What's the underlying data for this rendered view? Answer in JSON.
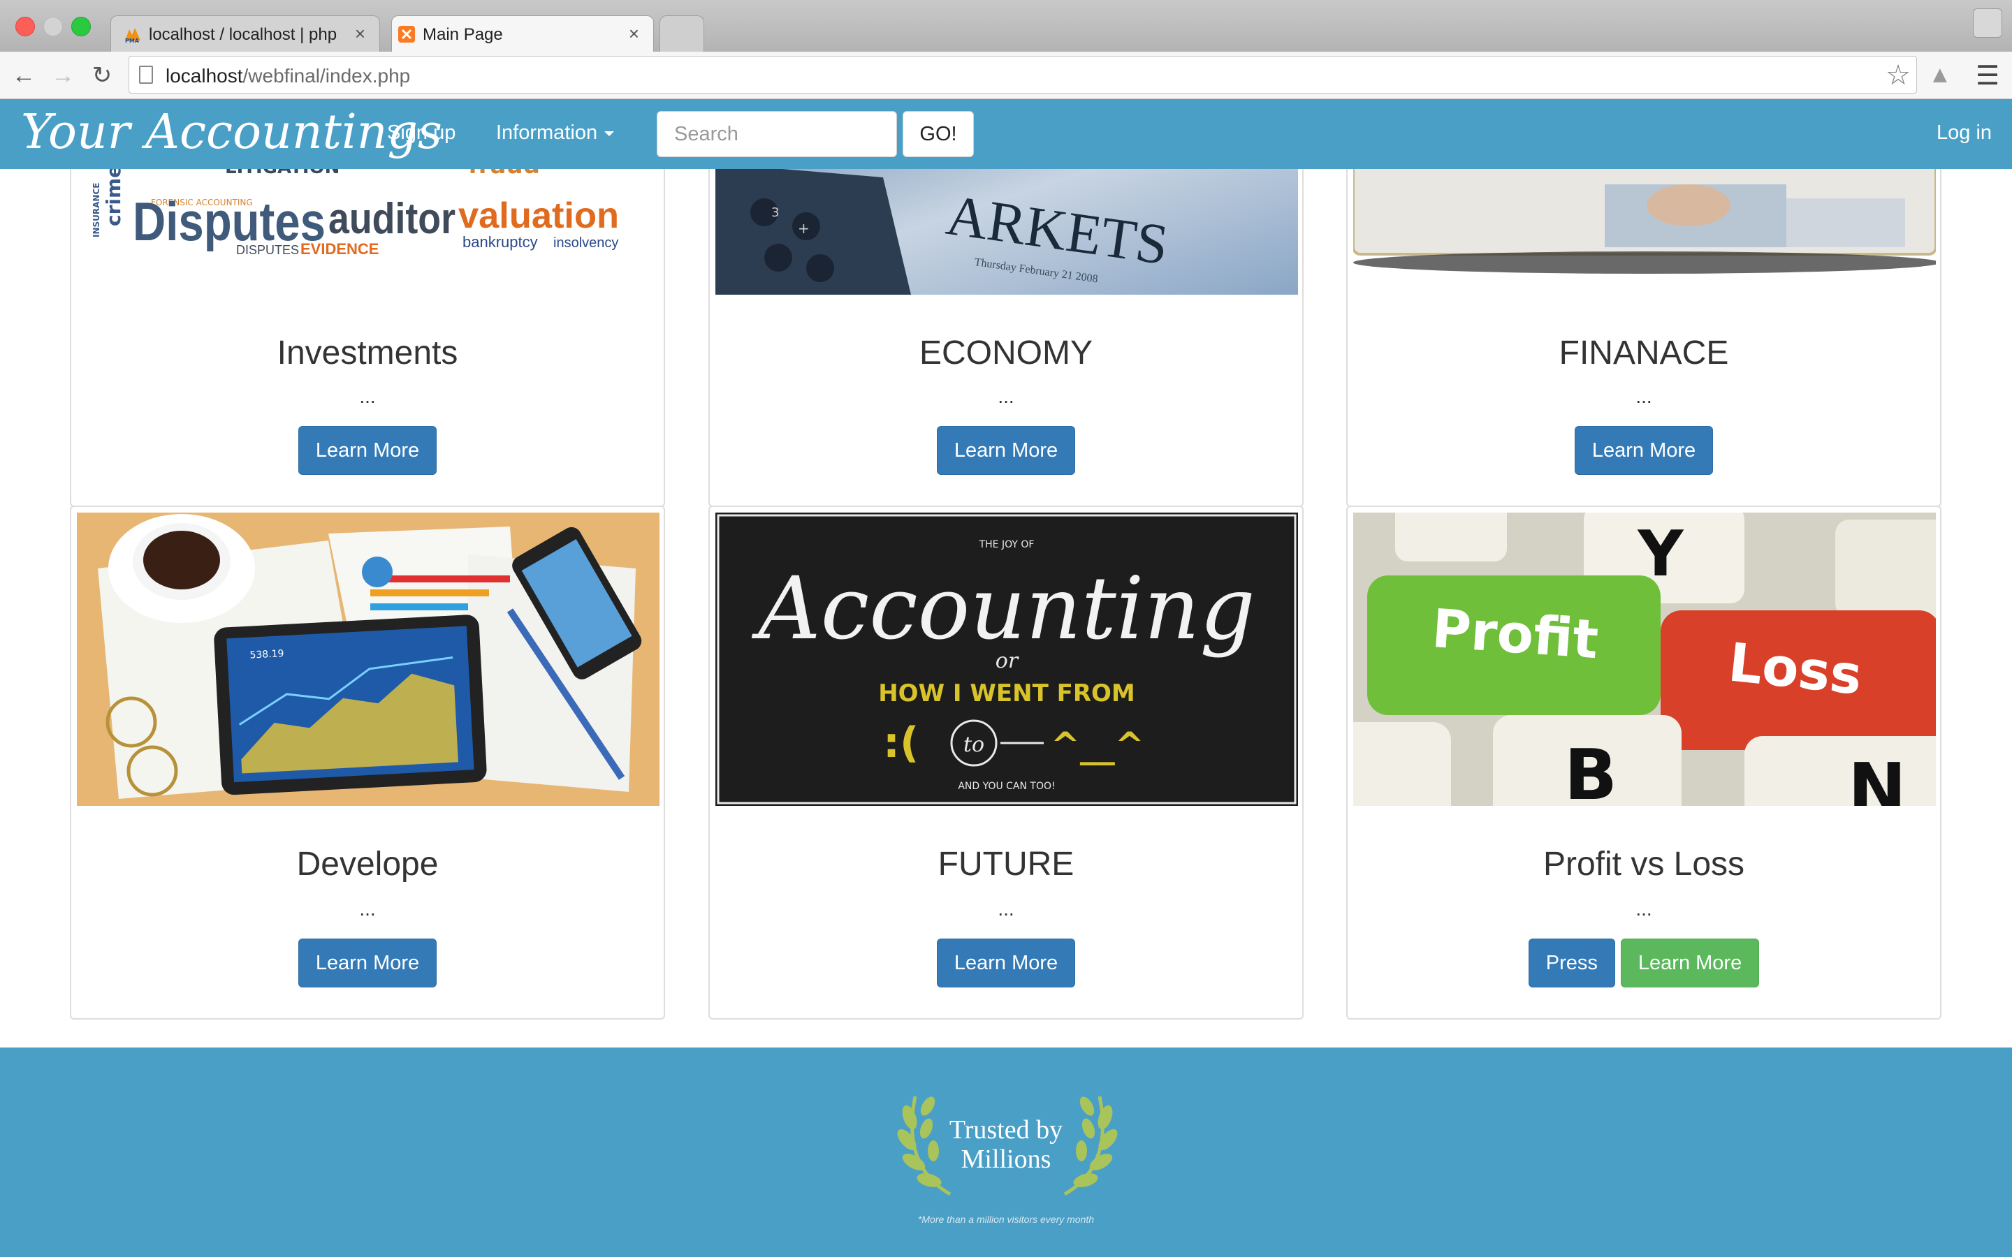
{
  "browser": {
    "tabs": [
      {
        "label": "localhost / localhost | phpMyAdmin",
        "favicon": "pma-icon"
      },
      {
        "label": "Main Page",
        "favicon": "xampp-icon"
      }
    ],
    "close_glyph": "×",
    "url_host": "localhost",
    "url_path": "/webfinal/index.php"
  },
  "nav": {
    "brand": "Your Accountings",
    "signup": "Sign up",
    "information": "Information",
    "search_placeholder": "Search",
    "go": "GO!",
    "login": "Log in"
  },
  "cards": [
    {
      "title": "Investments",
      "text": "...",
      "buttons": [
        "Learn More"
      ],
      "image": "word-cloud: Disputes, auditor, valuation, crime, insurance, bankruptcy, insolvency, evidence"
    },
    {
      "title": "ECONOMY",
      "text": "...",
      "buttons": [
        "Learn More"
      ],
      "image": "calculator-markets-newspaper"
    },
    {
      "title": "FINANACE",
      "text": "...",
      "buttons": [
        "Learn More"
      ],
      "image": "handshake-photo"
    },
    {
      "title": "Develope",
      "text": "...",
      "buttons": [
        "Learn More"
      ],
      "image": "tablet-charts-coffee"
    },
    {
      "title": "FUTURE",
      "text": "...",
      "buttons": [
        "Learn More"
      ],
      "image": "chalkboard-accounting"
    },
    {
      "title": "Profit vs Loss",
      "text": "...",
      "buttons": [
        "Press",
        "Learn More"
      ],
      "image": "profit-loss-keyboard"
    }
  ],
  "image_text": {
    "markets": "ARKETS",
    "markets_date": "Thursday February 21 2008",
    "tablet_value": "538.19",
    "joy": "THE JOY OF",
    "accounting": "Accounting",
    "or": "or",
    "how": "HOW I WENT FROM",
    "to": "to",
    "and_you": "AND YOU CAN TOO!",
    "key_profit": "Profit",
    "key_loss": "Loss",
    "key_y": "Y",
    "key_b": "B",
    "key_n": "N"
  },
  "word_cloud": {
    "disputes": "Disputes",
    "auditor": "auditor",
    "valuation": "valuation",
    "crime": "crime",
    "insurance": "INSURANCE",
    "bankruptcy": "bankruptcy",
    "insolvency": "insolvency",
    "evidence": "EVIDENCE",
    "disputes_small": "DISPUTES",
    "forensic": "FORENSIC ACCOUNTING",
    "litigation": "LITIGATION",
    "fraud": "fraud"
  },
  "footer": {
    "badge_line1": "Trusted by",
    "badge_line2": "Millions",
    "note": "*More than a million visitors every month"
  },
  "colors": {
    "brand_blue": "#4a9fc7",
    "primary": "#337ab7",
    "success": "#5cb85c"
  }
}
